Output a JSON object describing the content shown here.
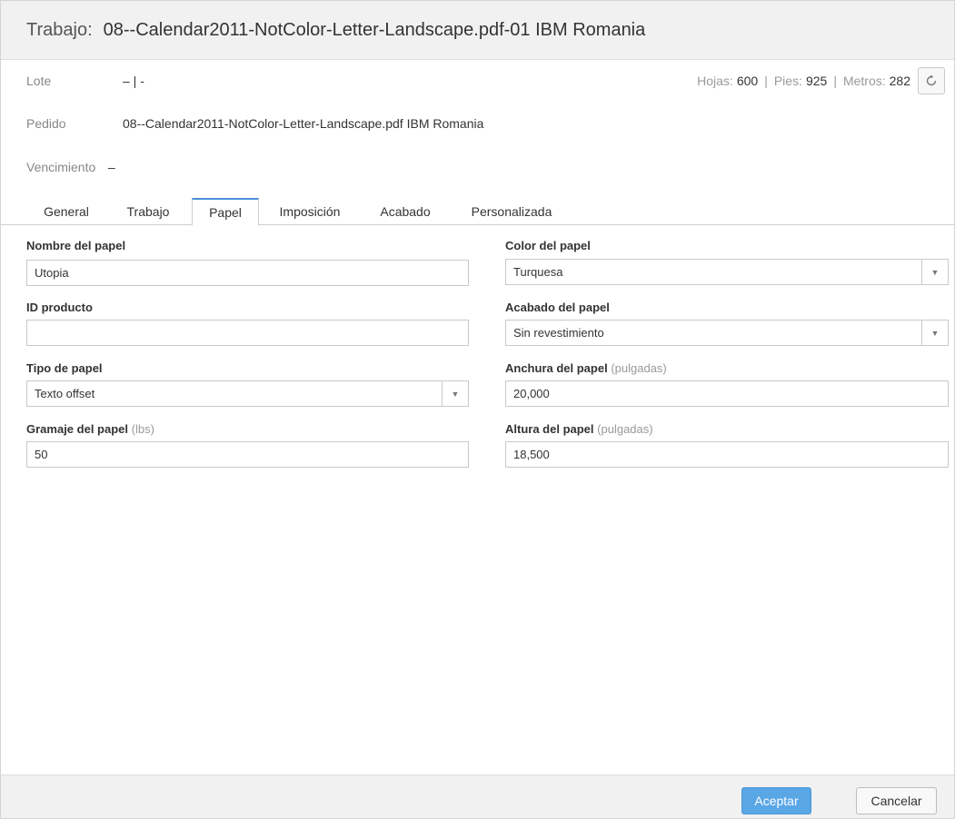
{
  "header": {
    "prefix": "Trabajo:",
    "title": "08--Calendar2011-NotColor-Letter-Landscape.pdf-01 IBM Romania"
  },
  "info": {
    "lote_label": "Lote",
    "lote_value": "– | -",
    "pedido_label": "Pedido",
    "pedido_value": "08--Calendar2011-NotColor-Letter-Landscape.pdf IBM Romania",
    "vencimiento_label": "Vencimiento",
    "vencimiento_value": "–"
  },
  "stats": {
    "hojas_label": "Hojas:",
    "hojas_value": "600",
    "pies_label": "Pies:",
    "pies_value": "925",
    "metros_label": "Metros:",
    "metros_value": "282",
    "separator": "|",
    "refresh_icon": "refresh-icon"
  },
  "tabs": [
    {
      "label": "General"
    },
    {
      "label": "Trabajo"
    },
    {
      "label": "Papel",
      "active": true
    },
    {
      "label": "Imposición"
    },
    {
      "label": "Acabado"
    },
    {
      "label": "Personalizada"
    }
  ],
  "form": {
    "nombre_label": "Nombre del papel",
    "nombre_value": "Utopia",
    "id_label": "ID producto",
    "id_value": "",
    "tipo_label": "Tipo de papel",
    "tipo_value": "Texto offset",
    "gramaje_label": "Gramaje del papel",
    "gramaje_unit": "(lbs)",
    "gramaje_value": "50",
    "color_label": "Color del papel",
    "color_value": "Turquesa",
    "acabado_label": "Acabado del papel",
    "acabado_value": "Sin revestimiento",
    "anchura_label": "Anchura del papel",
    "anchura_unit": "(pulgadas)",
    "anchura_value": "20,000",
    "altura_label": "Altura del papel",
    "altura_unit": "(pulgadas)",
    "altura_value": "18,500"
  },
  "footer": {
    "accept_label": "Aceptar",
    "cancel_label": "Cancelar"
  },
  "colors": {
    "accent": "#5aa7e6",
    "tab_active_border": "#4a90d9",
    "header_bg": "#f1f1f1"
  }
}
